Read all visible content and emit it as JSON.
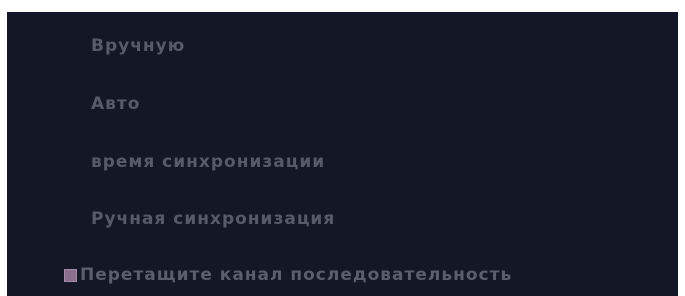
{
  "menu": {
    "items": [
      {
        "label": "Вручную"
      },
      {
        "label": "Авто"
      },
      {
        "label": "время синхронизации"
      },
      {
        "label": "Ручная синхронизация"
      }
    ]
  },
  "drag_option": {
    "label": "Перетащите канал последовательность",
    "checked": true
  },
  "colors": {
    "background": "#141826",
    "text": "#575a67",
    "checkbox": "#8a6f8e"
  }
}
